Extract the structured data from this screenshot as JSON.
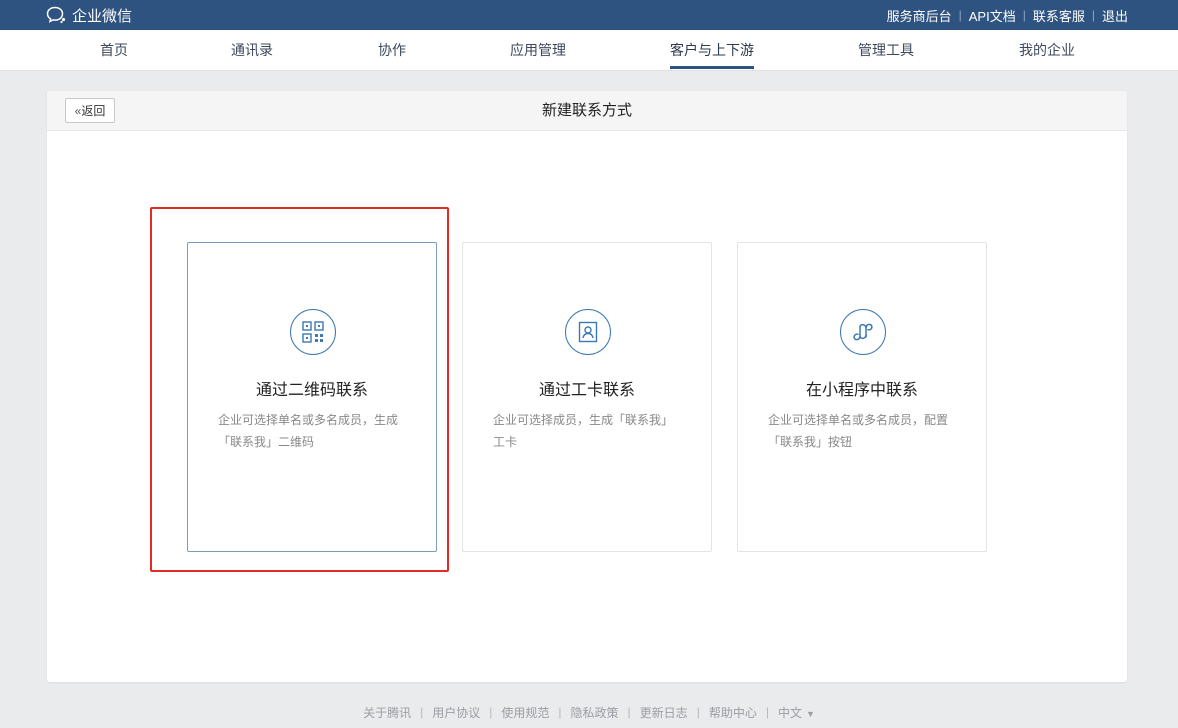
{
  "topbar": {
    "brand": "企业微信",
    "links": [
      "服务商后台",
      "API文档",
      "联系客服",
      "退出"
    ],
    "separator": "|"
  },
  "nav": {
    "items": [
      "首页",
      "通讯录",
      "协作",
      "应用管理",
      "客户与上下游",
      "管理工具",
      "我的企业"
    ],
    "active_index": 4
  },
  "panel": {
    "back_label": "返回",
    "back_chevron": "«",
    "title": "新建联系方式"
  },
  "cards": [
    {
      "title": "通过二维码联系",
      "desc": "企业可选择单名或多名成员，生成「联系我」二维码",
      "icon": "qr-code-icon"
    },
    {
      "title": "通过工卡联系",
      "desc": "企业可选择成员，生成「联系我」工卡",
      "icon": "badge-card-icon"
    },
    {
      "title": "在小程序中联系",
      "desc": "企业可选择单名或多名成员，配置「联系我」按钮",
      "icon": "mini-program-icon"
    }
  ],
  "footer": {
    "links": [
      "关于腾讯",
      "用户协议",
      "使用规范",
      "隐私政策",
      "更新日志",
      "帮助中心"
    ],
    "language": "中文",
    "language_caret": "▼",
    "separator": "|"
  },
  "colors": {
    "topbar": "#2e5381",
    "accent": "#3b78b4",
    "highlight": "#e02b27"
  }
}
